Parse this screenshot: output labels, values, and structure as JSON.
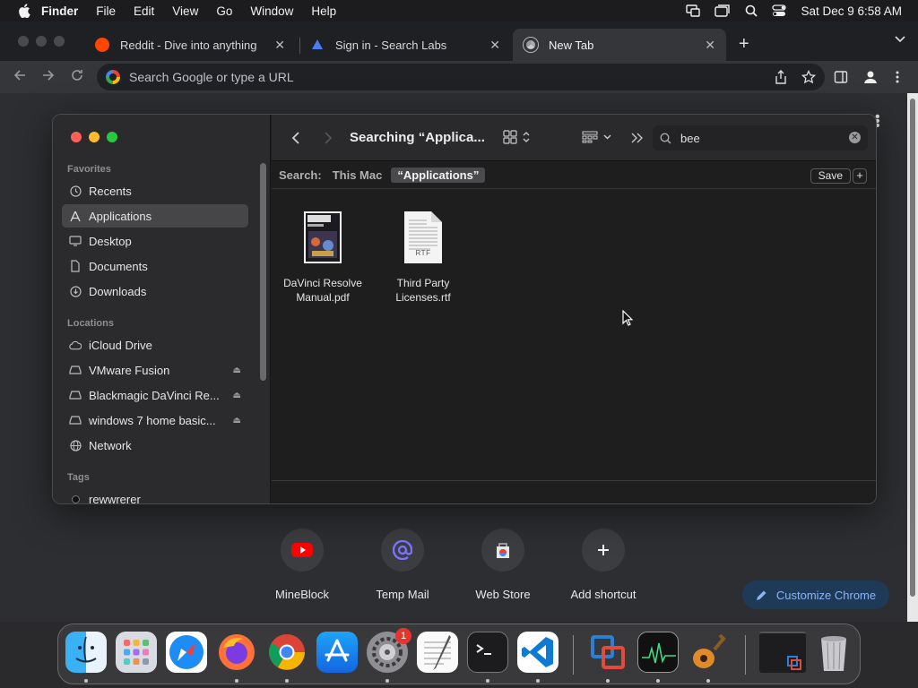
{
  "menubar": {
    "app_name": "Finder",
    "menus": [
      "File",
      "Edit",
      "View",
      "Go",
      "Window",
      "Help"
    ],
    "datetime": "Sat Dec 9  6:58 AM"
  },
  "browser": {
    "tabs": [
      {
        "title": "Reddit - Dive into anything",
        "close": "✕",
        "icon": "reddit-icon"
      },
      {
        "title": "Sign in - Search Labs",
        "close": "✕",
        "icon": "search-labs-icon"
      },
      {
        "title": "New Tab",
        "close": "✕",
        "icon": "chrome-icon"
      }
    ],
    "new_tab": "+",
    "omnibox_placeholder": "Search Google or type a URL",
    "ntp": {
      "shortcuts": [
        {
          "label": "MineBlock",
          "icon": "youtube-icon"
        },
        {
          "label": "Temp Mail",
          "icon": "at-icon"
        },
        {
          "label": "Web Store",
          "icon": "webstore-icon"
        },
        {
          "label": "Add shortcut",
          "icon": "plus-icon"
        }
      ],
      "customize_label": "Customize Chrome"
    }
  },
  "finder": {
    "title": "Searching “Applica...",
    "search_value": "bee",
    "scope": {
      "label": "Search:",
      "options": [
        "This Mac",
        "“Applications”"
      ],
      "save": "Save",
      "add": "+"
    },
    "sidebar": {
      "favorites_header": "Favorites",
      "favorites": [
        {
          "label": "Recents",
          "icon": "clock-icon"
        },
        {
          "label": "Applications",
          "icon": "applications-icon",
          "selected": true
        },
        {
          "label": "Desktop",
          "icon": "desktop-icon"
        },
        {
          "label": "Documents",
          "icon": "document-icon"
        },
        {
          "label": "Downloads",
          "icon": "download-icon"
        }
      ],
      "locations_header": "Locations",
      "locations": [
        {
          "label": "iCloud Drive",
          "icon": "cloud-icon"
        },
        {
          "label": "VMware Fusion",
          "icon": "drive-icon",
          "eject": true
        },
        {
          "label": "Blackmagic DaVinci Re...",
          "icon": "drive-icon",
          "eject": true
        },
        {
          "label": "windows 7 home basic...",
          "icon": "drive-icon",
          "eject": true
        },
        {
          "label": "Network",
          "icon": "globe-icon"
        }
      ],
      "tags_header": "Tags",
      "tags": [
        {
          "label": "rewwrerer",
          "color": "#111111"
        }
      ]
    },
    "files": [
      {
        "name_line1": "DaVinci Resolve",
        "name_line2": "Manual.pdf",
        "icon": "pdf-thumbnail"
      },
      {
        "name_line1": "Third Party",
        "name_line2": "Licenses.rtf",
        "icon": "rtf-document-icon",
        "badge": "RTF"
      }
    ]
  },
  "dock": {
    "apps": [
      "Finder",
      "Launchpad",
      "Safari",
      "Firefox",
      "Chrome",
      "App Store",
      "System Settings",
      "TextEdit",
      "Terminal",
      "VS Code",
      "VMware Fusion",
      "Activity Monitor",
      "GarageBand",
      "Screen",
      "Trash"
    ],
    "settings_badge": "1"
  }
}
